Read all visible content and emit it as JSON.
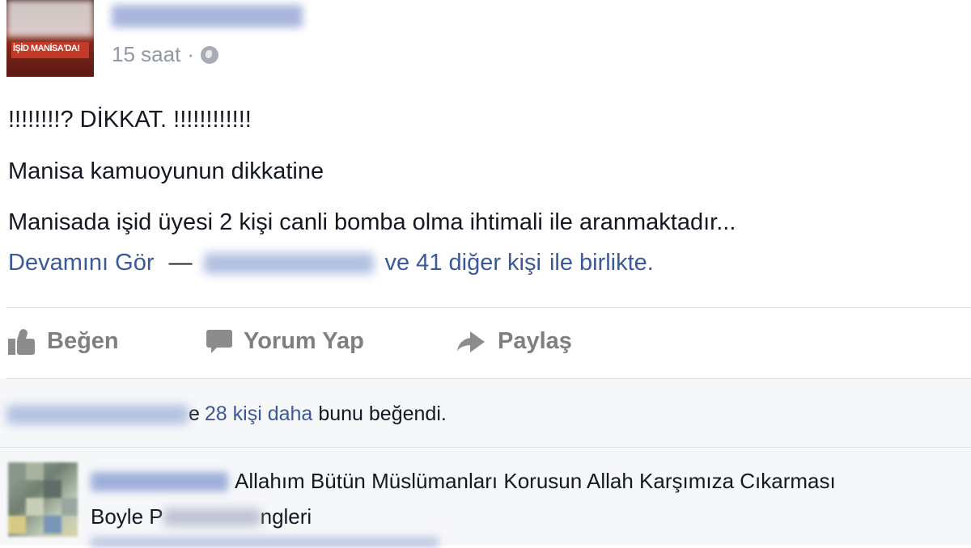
{
  "post": {
    "time": "15 saat",
    "time_separator": "·",
    "privacy_icon": "globe-icon",
    "line1": "!!!!!!!!? DİKKAT. !!!!!!!!!!!!",
    "line2": "Manisa kamuoyunun dikkatine",
    "line3": "Manisada işid üyesi 2 kişi canli bomba olma ihtimali ile aranmaktadır...",
    "see_more": "Devamını Gör",
    "dash": "—",
    "with_others": "ve 41 diğer kişi",
    "with_suffix": "ile birlikte."
  },
  "avatar_caption": "İŞİD MANİSA'DA!",
  "actions": {
    "like": "Beğen",
    "comment": "Yorum Yap",
    "share": "Paylaş"
  },
  "likes": {
    "trailing_char": "e",
    "others": "28 kişi daha",
    "suffix": "bunu beğendi."
  },
  "comment": {
    "text1": "Allahım Bütün Müslümanları Korusun Allah Karşımıza Cıkarması",
    "text2_prefix": "Boyle P",
    "text2_suffix": "ngleri"
  },
  "colors": {
    "link": "#3b5998",
    "text": "#141823",
    "muted": "#9197a3",
    "action": "#7f7f7f"
  }
}
